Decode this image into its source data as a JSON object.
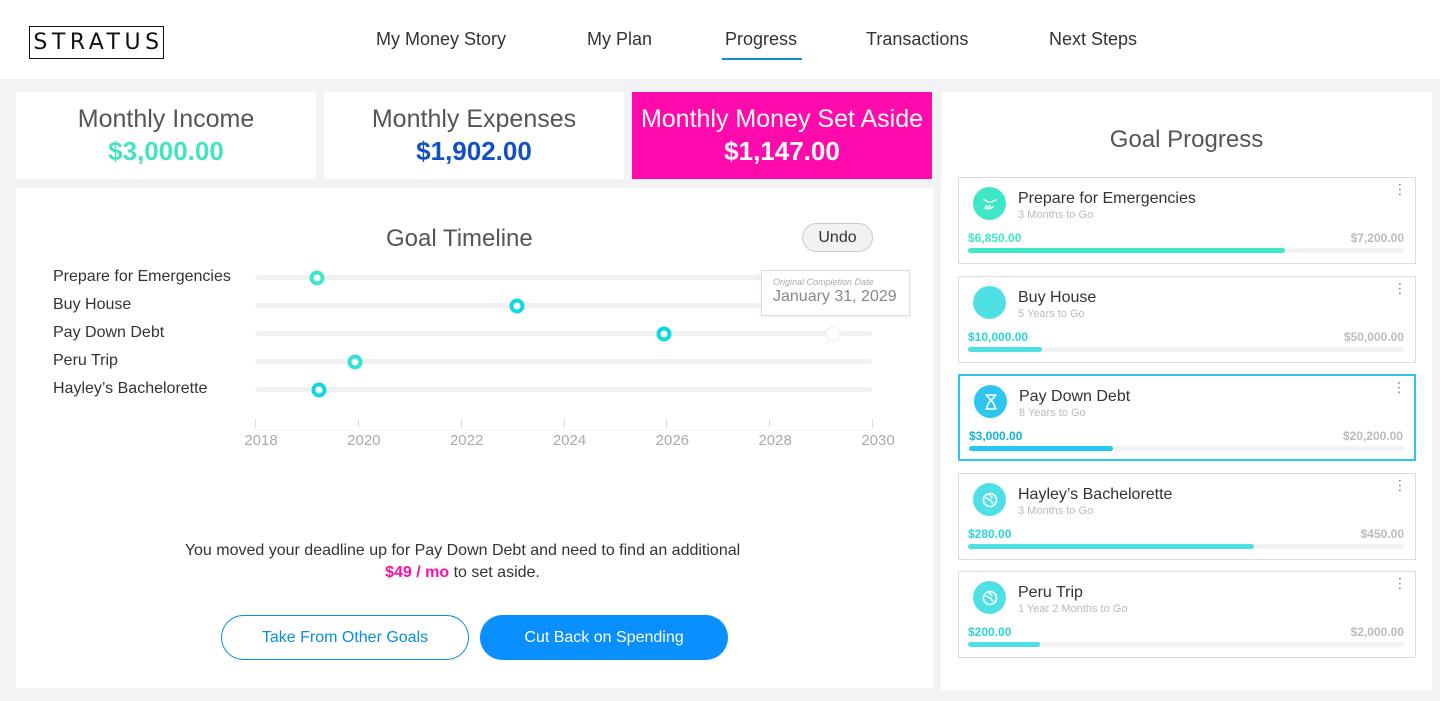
{
  "brand": "STRATUS",
  "nav": [
    {
      "label": "My Money Story"
    },
    {
      "label": "My Plan"
    },
    {
      "label": "Progress",
      "active": true
    },
    {
      "label": "Transactions"
    },
    {
      "label": "Next Steps"
    }
  ],
  "stats": {
    "income": {
      "label": "Monthly Income",
      "value": "$3,000.00",
      "color": "#44e3c4"
    },
    "expenses": {
      "label": "Monthly Expenses",
      "value": "$1,902.00",
      "color": "#1251c4"
    },
    "set_aside": {
      "label": "Monthly Money Set Aside",
      "value": "$1,147.00",
      "background": "#ff0aac"
    }
  },
  "timeline": {
    "title": "Goal Timeline",
    "undo_label": "Undo",
    "axis": {
      "min": 2018,
      "max": 2030,
      "ticks": [
        "2018",
        "2020",
        "2022",
        "2024",
        "2026",
        "2028",
        "2030"
      ]
    },
    "goals": [
      {
        "name": "Prepare for Emergencies",
        "year": 2019.2,
        "color": "#3ee8c6"
      },
      {
        "name": "Buy House",
        "year": 2023.1,
        "color": "#11d6e3"
      },
      {
        "name": "Pay Down Debt",
        "year": 2025.95,
        "color": "#11d6e3",
        "original_year": 2029.25
      },
      {
        "name": "Peru Trip",
        "year": 2019.95,
        "color": "#2de4cf"
      },
      {
        "name": "Hayley’s Bachelorette",
        "year": 2019.25,
        "color": "#11d6e3"
      }
    ],
    "tooltip": {
      "label": "Original Completion Date",
      "date": "January 31, 2029"
    },
    "message": {
      "text": "You moved your deadline up for Pay Down Debt and need to find an additional",
      "amount": "$49 / mo",
      "suffix": "to set aside."
    },
    "buttons": {
      "take_from": "Take From Other Goals",
      "cut_back": "Cut Back on Spending"
    }
  },
  "goal_progress": {
    "title": "Goal Progress",
    "goals": [
      {
        "name": "Prepare for Emergencies",
        "time_left": "3 Months to Go",
        "current": "$6,850.00",
        "target": "$7,200.00",
        "progress": 0.727,
        "icon": "hands-icon",
        "icon_color": "#3ee8c6",
        "amount_color": "#3ee8c6",
        "bar_color": "#3ee8c6",
        "selected": false
      },
      {
        "name": "Buy House",
        "time_left": "5 Years to Go",
        "current": "$10,000.00",
        "target": "$50,000.00",
        "progress": 0.17,
        "icon": "house-icon",
        "icon_color": "#4fe0e6",
        "amount_color": "#2ad5d9",
        "bar_color": "#4fe0e6",
        "selected": false
      },
      {
        "name": "Pay Down Debt",
        "time_left": "8 Years to Go",
        "current": "$3,000.00",
        "target": "$20,200.00",
        "progress": 0.33,
        "icon": "hourglass-icon",
        "icon_color": "#2ec6f0",
        "amount_color": "#11b3d8",
        "bar_color": "#24c7ee",
        "selected": true
      },
      {
        "name": "Hayley’s Bachelorette",
        "time_left": "3 Months to Go",
        "current": "$280.00",
        "target": "$450.00",
        "progress": 0.655,
        "icon": "globe-icon",
        "icon_color": "#4fe0e6",
        "amount_color": "#2ad5d9",
        "bar_color": "#4fe0e6",
        "selected": false
      },
      {
        "name": "Peru Trip",
        "time_left": "1 Year 2 Months to Go",
        "current": "$200.00",
        "target": "$2,000.00",
        "progress": 0.165,
        "icon": "globe-icon",
        "icon_color": "#4fe0e6",
        "amount_color": "#2ad5d9",
        "bar_color": "#4fe0e6",
        "selected": false
      }
    ]
  }
}
